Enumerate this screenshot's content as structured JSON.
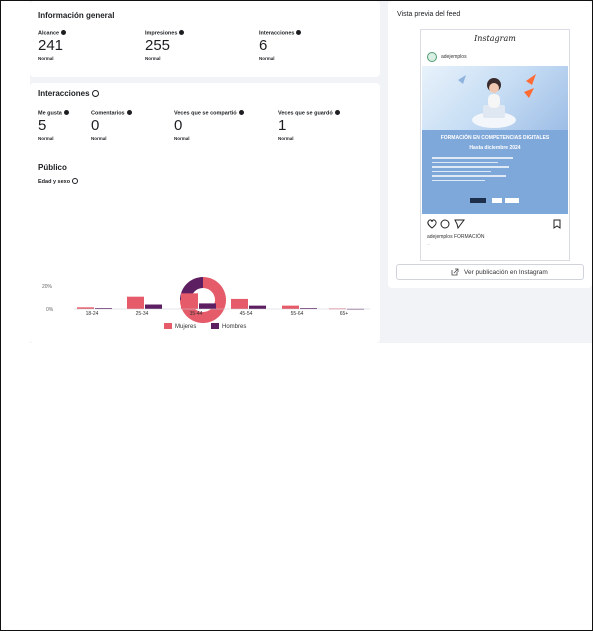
{
  "general_info": {
    "title": "Información general",
    "metrics": [
      {
        "label": "Alcance",
        "value": "241",
        "note": "Normal"
      },
      {
        "label": "Impresiones",
        "value": "255",
        "note": "Normal"
      },
      {
        "label": "Interacciones",
        "value": "6",
        "note": "Normal"
      }
    ]
  },
  "interactions": {
    "title": "Interacciones",
    "metrics": [
      {
        "label": "Me gusta",
        "value": "5",
        "note": "Normal"
      },
      {
        "label": "Comentarios",
        "value": "0",
        "note": "Normal"
      },
      {
        "label": "Veces que se compartió",
        "value": "0",
        "note": "Normal"
      },
      {
        "label": "Veces que se guardó",
        "value": "1",
        "note": "Normal"
      }
    ]
  },
  "audience": {
    "title": "Público",
    "subtitle": "Edad y sexo",
    "legend": [
      {
        "label": "Mujeres",
        "color": "#e55b69"
      },
      {
        "label": "Hombres",
        "color": "#5d1f61"
      }
    ]
  },
  "chart_data": {
    "type": "bar",
    "categories": [
      "18-24",
      "25-34",
      "35-44",
      "45-54",
      "55-64",
      "65+"
    ],
    "series": [
      {
        "name": "Mujeres",
        "values": [
          1.5,
          11,
          14,
          9,
          3,
          0.5
        ],
        "color": "#e55b69"
      },
      {
        "name": "Hombres",
        "values": [
          0.8,
          4,
          5,
          3,
          0.8,
          0.2
        ],
        "color": "#5d1f61"
      }
    ],
    "y_ticks": [
      "20%",
      "0%"
    ],
    "ylim": [
      0,
      25
    ],
    "xlabel": "",
    "ylabel": "",
    "legend_position": "bottom-center",
    "grid": false,
    "donut": {
      "segments": [
        {
          "name": "Mujeres",
          "value": 75,
          "color": "#e55b69"
        },
        {
          "name": "Hombres",
          "value": 25,
          "color": "#5d1f61"
        }
      ]
    }
  },
  "preview": {
    "title": "Vista previa del feed",
    "header": "Instagram",
    "username": "adejemplos",
    "post": {
      "headline": "FORMACIÓN EN COMPETENCIAS DIGITALES",
      "subheadline": "Hasta diciembre 2024",
      "caption": "adejemplos FORMACIÓN"
    },
    "button_label": "Ver publicación en Instagram"
  },
  "colors": {
    "female": "#e55b69",
    "male": "#5d1f61",
    "post_blue": "#7fa8da",
    "page_bg": "#f1f3f7"
  }
}
